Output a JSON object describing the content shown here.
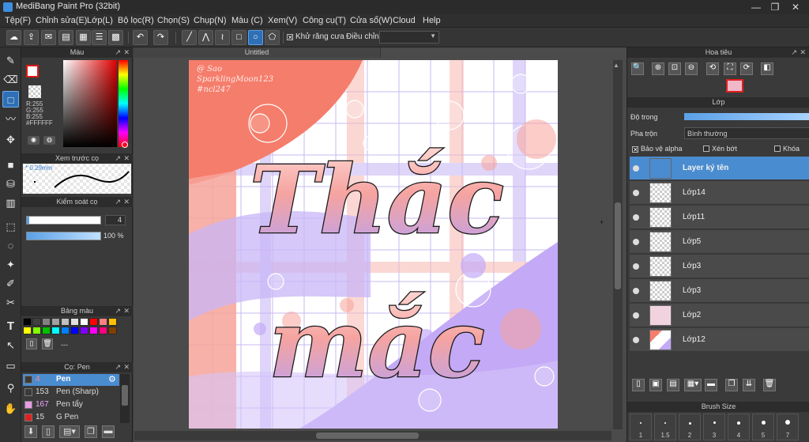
{
  "window": {
    "title": "MediBang Paint Pro (32bit)",
    "minimize": "—",
    "restore": "❐",
    "close": "✕"
  },
  "menu": [
    "Tệp(F)",
    "Chỉnh sửa(E)",
    "Lớp(L)",
    "Bộ lọc(R)",
    "Chọn(S)",
    "Chụp(N)",
    "Màu (C)",
    "Xem(V)",
    "Công cụ(T)",
    "Cửa sổ(W)",
    "Cloud",
    "Help"
  ],
  "toolbar": {
    "antialias_label": "Khử răng cưa",
    "adjust_label": "Điều chỉnh",
    "adjust_value": ""
  },
  "color_panel": {
    "title": "Màu",
    "r": "R:255",
    "g": "G:255",
    "b": "B:255",
    "hex": "#FFFFFF",
    "fg_color": "#ffffff",
    "bg_color": "#ffffff"
  },
  "brush_preview": {
    "title": "Xem trước cọ",
    "size": "0.29mm"
  },
  "brush_control": {
    "title": "Kiểm soát cọ",
    "size_value": "4",
    "opacity_value": "100 %"
  },
  "palette": {
    "title": "Bảng màu",
    "dash": "---",
    "swatches": [
      "#000000",
      "#404040",
      "#808080",
      "#a0a0a0",
      "#c0c0c0",
      "#e0e0e0",
      "#ffffff",
      "#ff0000",
      "#ff8080",
      "#ffc000",
      "#ffff00",
      "#80ff00",
      "#00c000",
      "#00ffff",
      "#0080ff",
      "#0000ff",
      "#8000ff",
      "#ff00ff",
      "#ff0080",
      "#804000"
    ]
  },
  "brush_list": {
    "title": "Cọ: Pen",
    "items": [
      {
        "size": "4",
        "name": "Pen",
        "color": "#3a3a3a"
      },
      {
        "size": "153",
        "name": "Pen (Sharp)",
        "color": "#3a3a3a"
      },
      {
        "size": "167",
        "name": "Pen tẩy",
        "color": "#e79de0"
      },
      {
        "size": "15",
        "name": "G Pen",
        "color": "#e02020"
      }
    ]
  },
  "canvas": {
    "tab_title": "Untitled",
    "signature": "@ Sao\nSparklingMoon123\n#ncl247",
    "text_line1": "Thắc",
    "text_line2": "mắc"
  },
  "navigator": {
    "title": "Hoa tiêu"
  },
  "layers": {
    "title": "Lớp",
    "opacity_label": "Độ trong",
    "blend_label": "Pha trộn",
    "blend_value": "Bình thường",
    "protect_alpha": "Bảo vệ alpha",
    "clipping": "Xén bớt",
    "lock": "Khóa",
    "items": [
      {
        "name": "Layer ký tên",
        "selected": true
      },
      {
        "name": "Lớp14",
        "selected": false
      },
      {
        "name": "Lớp11",
        "selected": false
      },
      {
        "name": "Lớp5",
        "selected": false
      },
      {
        "name": "Lớp3",
        "selected": false
      },
      {
        "name": "Lớp3",
        "selected": false
      },
      {
        "name": "Lớp2",
        "selected": false
      },
      {
        "name": "Lớp12",
        "selected": false
      }
    ]
  },
  "brush_size": {
    "title": "Brush Size",
    "values": [
      "1",
      "1.5",
      "2",
      "3",
      "4",
      "5",
      "7"
    ]
  }
}
